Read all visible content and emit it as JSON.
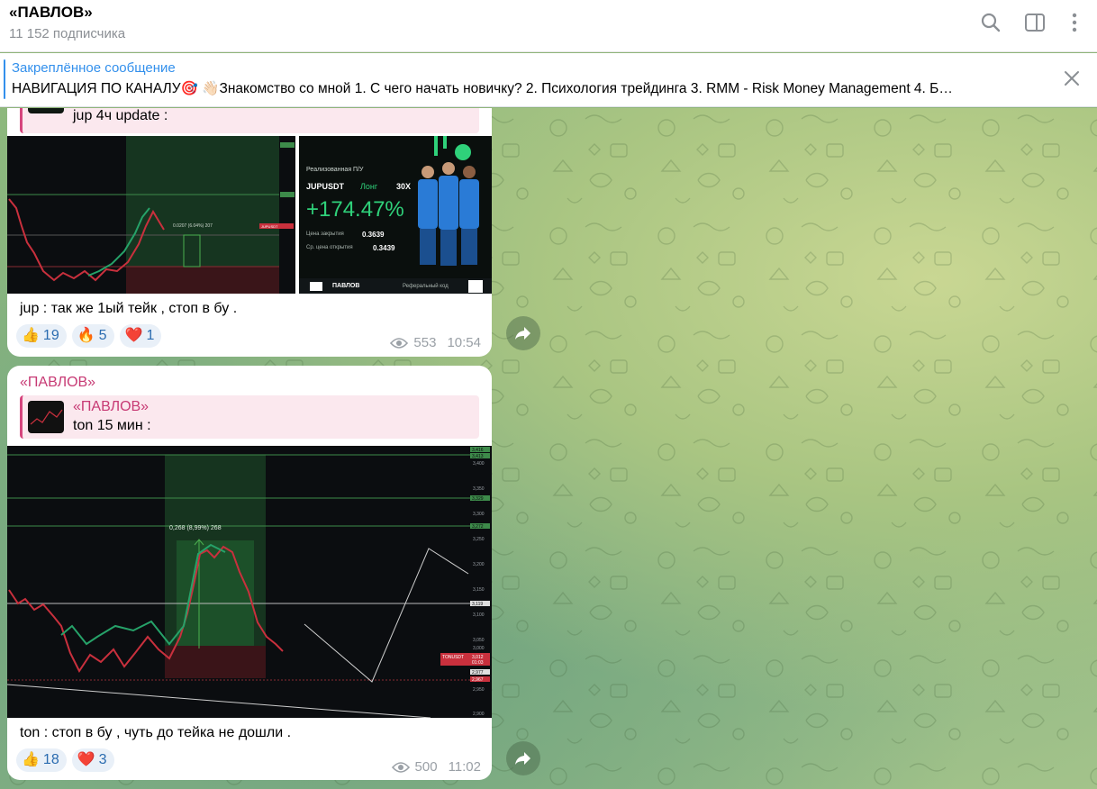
{
  "header": {
    "title": "«ПАВЛОВ»",
    "subscribers": "11 152 подписчика"
  },
  "pinned": {
    "title": "Закреплённое сообщение",
    "text": "НАВИГАЦИЯ ПО КАНАЛУ🎯 👋🏻Знакомство со мной  1. С чего начать новичку?  2. Психология трейдинга  3. RMM - Risk Money Management  4. Б…"
  },
  "messages": [
    {
      "reply_text": "jup 4ч update :",
      "caption": "jup : так же 1ый тейк , стоп в бу .",
      "reactions": [
        {
          "emoji": "👍",
          "count": "19"
        },
        {
          "emoji": "🔥",
          "count": "5"
        },
        {
          "emoji": "❤️",
          "count": "1"
        }
      ],
      "views": "553",
      "time": "10:54",
      "card": {
        "label": "Реализованная П/У",
        "pair": "JUPUSDT",
        "side": "Лонг",
        "leverage": "30X",
        "pnl": "+174.47%",
        "close_label": "Цена закрытия",
        "close_value": "0.3639",
        "open_label": "Ср. цена открытия",
        "open_value": "0.3439",
        "brand": "ПАВЛОВ",
        "ref_label": "Реферальный код"
      },
      "chart1": {
        "measure": "0.0207 (6.04%) 207",
        "tag": "JUPUSDT"
      }
    },
    {
      "author": "«ПАВЛОВ»",
      "reply_name": "«ПАВЛОВ»",
      "reply_text": "ton 15 мин :",
      "caption": "ton  : стоп в бу , чуть до тейка не дошли .",
      "reactions": [
        {
          "emoji": "👍",
          "count": "18"
        },
        {
          "emoji": "❤️",
          "count": "3"
        }
      ],
      "views": "500",
      "time": "11:02",
      "chart": {
        "measure": "0,268 (8,99%) 268",
        "tag": "TONUSDT",
        "tag_price": "3,012",
        "tag_time": "01:03",
        "levels": [
          "3,416",
          "3,413",
          "3,329",
          "3,272",
          "3,119",
          "2,977",
          "2,967"
        ],
        "axis": [
          "3,400",
          "3,350",
          "3,300",
          "3,250",
          "3,200",
          "3,150",
          "3,100",
          "3,050",
          "3,000",
          "2,950",
          "2,900"
        ]
      }
    }
  ],
  "colors": {
    "accent": "#3390ec",
    "author": "#c73a74",
    "reaction_bg": "#e9f0f8"
  }
}
